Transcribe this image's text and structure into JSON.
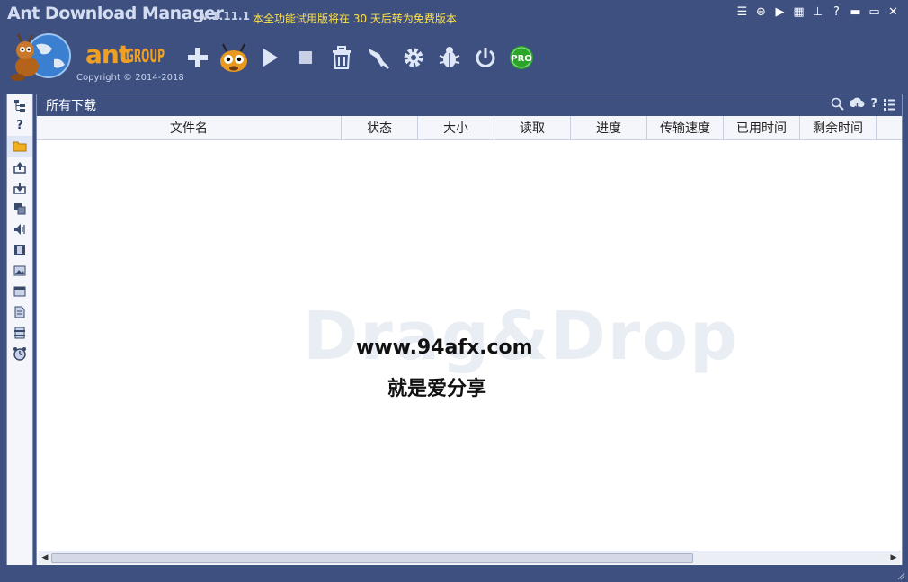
{
  "window": {
    "title": "Ant Download Manager",
    "version": "v.1.11.1",
    "trial_notice": "本全功能试用版将在 30 天后转为免费版本",
    "controls": [
      {
        "name": "menu-icon",
        "glyph": "☰"
      },
      {
        "name": "globe-icon",
        "glyph": "⊕"
      },
      {
        "name": "play-circle-icon",
        "glyph": "▶"
      },
      {
        "name": "grid-icon",
        "glyph": "▦"
      },
      {
        "name": "pin-icon",
        "glyph": "⊥"
      },
      {
        "name": "help-icon",
        "glyph": "?"
      },
      {
        "name": "minimize-icon",
        "glyph": "▬"
      },
      {
        "name": "maximize-icon",
        "glyph": "▭"
      },
      {
        "name": "close-icon",
        "glyph": "✕"
      }
    ]
  },
  "brand": {
    "name_ant": "ant",
    "name_group": "GROUP",
    "copyright": "Copyright © 2014-2018"
  },
  "toolbar": {
    "buttons": [
      {
        "name": "add-download-button",
        "icon": "plus-icon"
      },
      {
        "name": "ant-catcher-button",
        "icon": "ant-face-icon"
      },
      {
        "name": "start-button",
        "icon": "play-icon"
      },
      {
        "name": "stop-button",
        "icon": "stop-icon"
      },
      {
        "name": "delete-button",
        "icon": "trash-icon"
      },
      {
        "name": "rocket-button",
        "icon": "rocket-icon"
      },
      {
        "name": "settings-button",
        "icon": "gear-icon"
      },
      {
        "name": "bug-report-button",
        "icon": "bug-icon"
      },
      {
        "name": "power-button",
        "icon": "power-icon"
      },
      {
        "name": "pro-button",
        "icon": "pro-icon",
        "label": "PRO"
      }
    ]
  },
  "sidebar": {
    "items": [
      {
        "name": "sidebar-item-tree",
        "icon": "tree-icon"
      },
      {
        "name": "sidebar-item-unknown",
        "icon": "question-icon"
      },
      {
        "name": "sidebar-item-folder",
        "icon": "folder-icon"
      },
      {
        "name": "sidebar-item-upload",
        "icon": "upload-icon"
      },
      {
        "name": "sidebar-item-download",
        "icon": "download-icon"
      },
      {
        "name": "sidebar-item-copy",
        "icon": "copy-icon"
      },
      {
        "name": "sidebar-item-audio",
        "icon": "speaker-icon"
      },
      {
        "name": "sidebar-item-video",
        "icon": "film-icon"
      },
      {
        "name": "sidebar-item-image",
        "icon": "picture-icon"
      },
      {
        "name": "sidebar-item-program",
        "icon": "window-icon"
      },
      {
        "name": "sidebar-item-document",
        "icon": "document-icon"
      },
      {
        "name": "sidebar-item-archive",
        "icon": "archive-icon"
      },
      {
        "name": "sidebar-item-scheduler",
        "icon": "alarm-clock-icon"
      }
    ]
  },
  "panel": {
    "title": "所有下载",
    "tools": [
      "search-icon",
      "cloud-download-icon",
      "help-icon",
      "list-icon"
    ],
    "columns": [
      "文件名",
      "状态",
      "大小",
      "读取",
      "进度",
      "传输速度",
      "已用时间",
      "剩余时间"
    ],
    "watermark": "Drag&Drop",
    "overlay_url": "www.94afx.com",
    "overlay_sub": "就是爱分享"
  },
  "colors": {
    "chrome": "#3d5080",
    "trial_text": "#ffe14a",
    "brand_orange": "#f0a020",
    "pro_green": "#2aa52a"
  }
}
